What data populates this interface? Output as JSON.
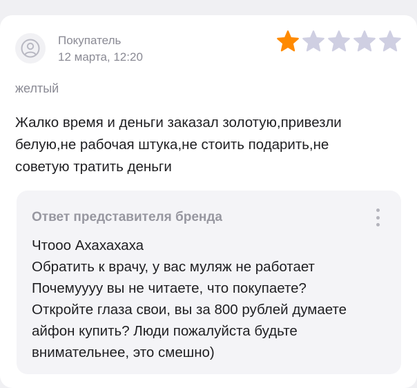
{
  "review": {
    "author": "Покупатель",
    "date": "12 марта, 12:20",
    "rating": 1,
    "rating_max": 5,
    "variant": "желтый",
    "text_lines": [
      "Жалко время и деньги заказал золотую,привезли",
      "белую,не рабочая штука,не стоить подарить,не",
      "советую тратить деньги"
    ]
  },
  "brand_reply": {
    "title": "Ответ представителя бренда",
    "lines": [
      "Чтооо Ахахахаха",
      "Обратить к врачу, у вас муляж не работает",
      "Почемуууу вы не читаете, что покупаете?",
      "Откройте глаза свои, вы за 800 рублей думаете",
      "айфон купить? Люди пожалуйста будьте",
      "внимательнее, это смешно)"
    ]
  },
  "icons": {
    "avatar": "user-avatar-icon",
    "star": "star-icon",
    "more": "more-vertical-icon"
  },
  "colors": {
    "star_filled": "#ff8a00",
    "star_empty": "#cfcfe2",
    "secondary_text": "#8a8a94",
    "reply_background": "#f4f4f7"
  }
}
